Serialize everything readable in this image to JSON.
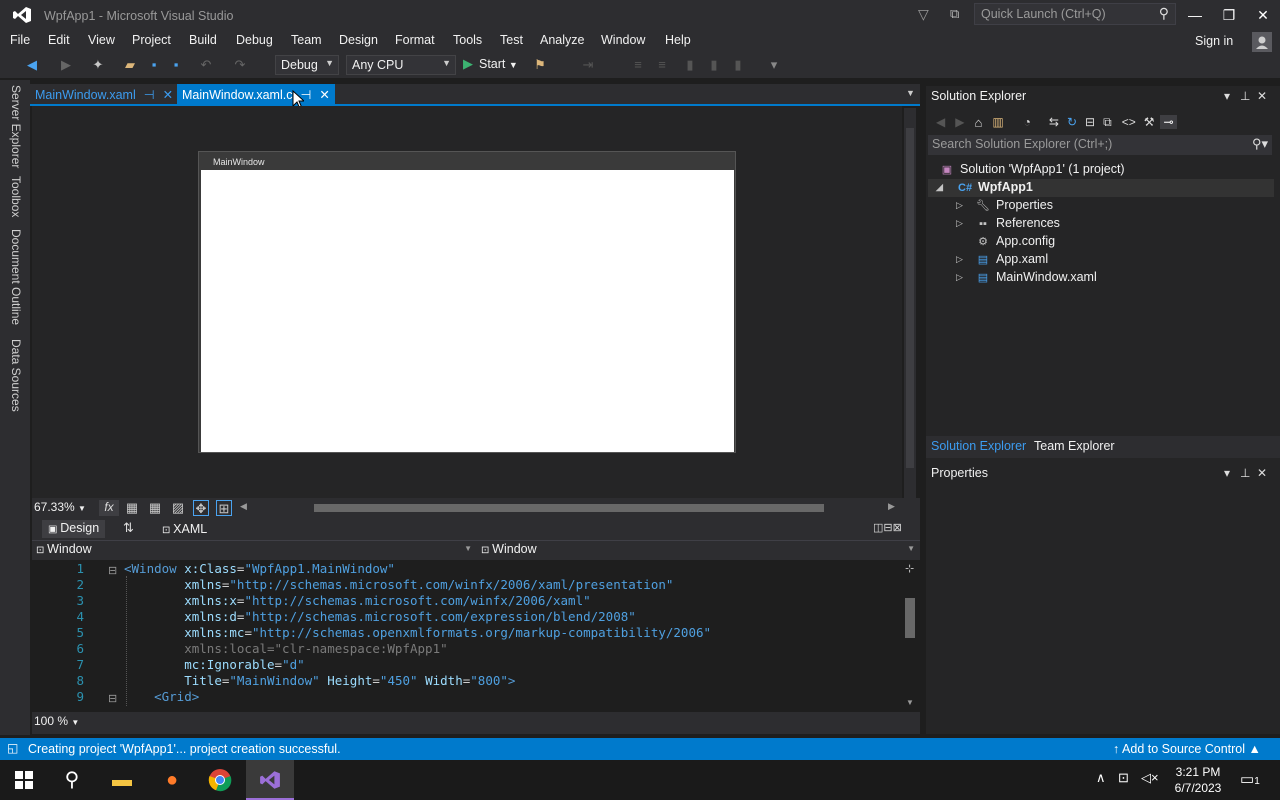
{
  "window": {
    "title": "WpfApp1 - Microsoft Visual Studio",
    "quick_launch_placeholder": "Quick Launch (Ctrl+Q)",
    "sign_in": "Sign in"
  },
  "menu": [
    "File",
    "Edit",
    "View",
    "Project",
    "Build",
    "Debug",
    "Team",
    "Design",
    "Format",
    "Tools",
    "Test",
    "Analyze",
    "Window",
    "Help"
  ],
  "toolbar": {
    "configuration": "Debug",
    "platform": "Any CPU",
    "start_label": "Start"
  },
  "side_tabs": [
    "Server Explorer",
    "Toolbox",
    "Document Outline",
    "Data Sources"
  ],
  "doc_tabs": [
    {
      "label": "MainWindow.xaml",
      "active": false
    },
    {
      "label": "MainWindow.xaml.c",
      "active": true
    }
  ],
  "designer": {
    "window_title": "MainWindow",
    "zoom": "67.33%",
    "fx_label": "fx",
    "design_tab": "Design",
    "xaml_tab": "XAML",
    "nav_left": "Window",
    "nav_right": "Window"
  },
  "code": {
    "lines": [
      {
        "num": "1",
        "indent": "",
        "parts": [
          [
            "tag",
            "<Window "
          ],
          [
            "attr",
            "x:Class"
          ],
          [
            "pl",
            "="
          ],
          [
            "str",
            "\"WpfApp1.MainWindow\""
          ]
        ]
      },
      {
        "num": "2",
        "indent": "        ",
        "parts": [
          [
            "attr",
            "xmlns"
          ],
          [
            "pl",
            "="
          ],
          [
            "str",
            "\"http://schemas.microsoft.com/winfx/2006/xaml/presentation\""
          ]
        ]
      },
      {
        "num": "3",
        "indent": "        ",
        "parts": [
          [
            "attr",
            "xmlns:x"
          ],
          [
            "pl",
            "="
          ],
          [
            "str",
            "\"http://schemas.microsoft.com/winfx/2006/xaml\""
          ]
        ]
      },
      {
        "num": "4",
        "indent": "        ",
        "parts": [
          [
            "attr",
            "xmlns:d"
          ],
          [
            "pl",
            "="
          ],
          [
            "str",
            "\"http://schemas.microsoft.com/expression/blend/2008\""
          ]
        ]
      },
      {
        "num": "5",
        "indent": "        ",
        "parts": [
          [
            "attr",
            "xmlns:mc"
          ],
          [
            "pl",
            "="
          ],
          [
            "str",
            "\"http://schemas.openxmlformats.org/markup-compatibility/2006\""
          ]
        ]
      },
      {
        "num": "6",
        "indent": "        ",
        "parts": [
          [
            "dim",
            "xmlns:local=\"clr-namespace:WpfApp1\""
          ]
        ]
      },
      {
        "num": "7",
        "indent": "        ",
        "parts": [
          [
            "attr",
            "mc:Ignorable"
          ],
          [
            "pl",
            "="
          ],
          [
            "str",
            "\"d\""
          ]
        ]
      },
      {
        "num": "8",
        "indent": "        ",
        "parts": [
          [
            "attr",
            "Title"
          ],
          [
            "pl",
            "="
          ],
          [
            "str",
            "\"MainWindow\""
          ],
          [
            "pl",
            " "
          ],
          [
            "attr",
            "Height"
          ],
          [
            "pl",
            "="
          ],
          [
            "str",
            "\"450\""
          ],
          [
            "pl",
            " "
          ],
          [
            "attr",
            "Width"
          ],
          [
            "pl",
            "="
          ],
          [
            "str",
            "\"800\""
          ],
          [
            "tag",
            ">"
          ]
        ]
      },
      {
        "num": "9",
        "indent": "    ",
        "parts": [
          [
            "tag",
            "<Grid>"
          ]
        ]
      }
    ],
    "zoom": "100 %"
  },
  "solution_explorer": {
    "title": "Solution Explorer",
    "search_placeholder": "Search Solution Explorer (Ctrl+;)",
    "solution": "Solution 'WpfApp1' (1 project)",
    "project": "WpfApp1",
    "items": [
      "Properties",
      "References",
      "App.config",
      "App.xaml",
      "MainWindow.xaml"
    ],
    "tabs": [
      "Solution Explorer",
      "Team Explorer"
    ]
  },
  "properties": {
    "title": "Properties"
  },
  "status": {
    "message": "Creating project 'WpfApp1'... project creation successful.",
    "source_control": "Add to Source Control"
  },
  "taskbar": {
    "time": "3:21 PM",
    "date": "6/7/2023",
    "notification_count": "1"
  },
  "colors": {
    "accent": "#007acc",
    "chrome": "#2d2d30",
    "editor": "#1e1e1e"
  }
}
